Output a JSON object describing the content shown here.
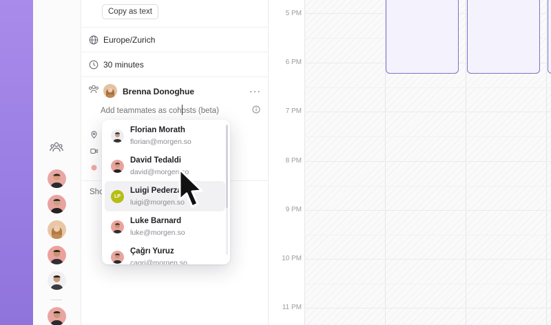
{
  "details": {
    "copy_button": "Copy as text",
    "timezone": "Europe/Zurich",
    "duration": "30 minutes",
    "host_name": "Brenna Donoghue",
    "cohost_placeholder": "Add teammates as cohosts (beta)",
    "show_more_partial": "Sho"
  },
  "cohost_dropdown": {
    "items": [
      {
        "name": "Florian Morath",
        "email": "florian@morgen.so",
        "avatar": "photo",
        "initials": ""
      },
      {
        "name": "David Tedaldi",
        "email": "david@morgen.so",
        "avatar": "photo",
        "initials": ""
      },
      {
        "name": "Luigi Pederzani",
        "email": "luigi@morgen.so",
        "avatar": "initials",
        "initials": "LP"
      },
      {
        "name": "Luke Barnard",
        "email": "luke@morgen.so",
        "avatar": "photo",
        "initials": ""
      },
      {
        "name": "Çağrı Yuruz",
        "email": "cagri@morgen.so",
        "avatar": "photo",
        "initials": ""
      }
    ],
    "highlighted_index": 2
  },
  "calendar": {
    "times": [
      "5 PM",
      "6 PM",
      "7 PM",
      "8 PM",
      "9 PM",
      "10 PM",
      "11 PM"
    ]
  },
  "colors": {
    "accent": "#7a70c8",
    "event_fill": "#f4f2fd",
    "rail_gradient": "#9c7fe4",
    "initials_avatar": "#b6bd17"
  },
  "icons": {
    "team": "team-icon",
    "timezone": "globe-icon",
    "duration": "clock-icon",
    "location": "location-pin-icon",
    "video": "video-icon",
    "info": "info-icon",
    "more": "more-options-icon"
  }
}
